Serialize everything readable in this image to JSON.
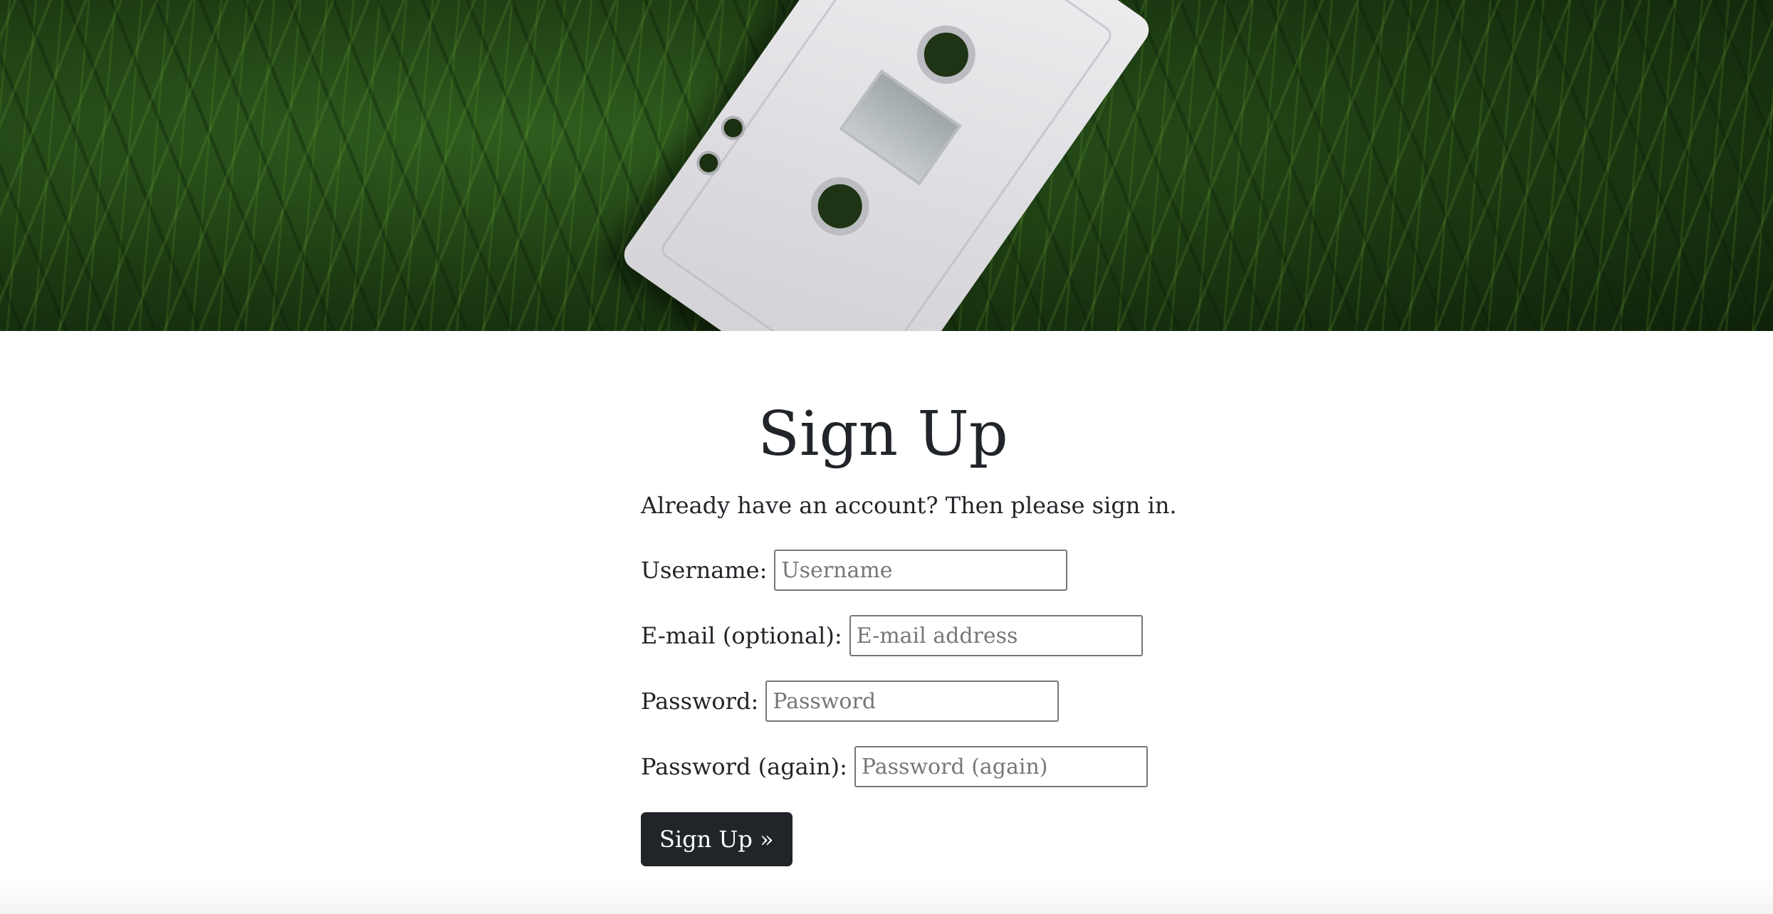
{
  "hero": {
    "image": "cassette-tape-on-grass-photo"
  },
  "signup": {
    "title": "Sign Up",
    "intro_prefix": "Already have an account? Then please ",
    "intro_link": "sign in",
    "intro_suffix": ".",
    "fields": {
      "username": {
        "label": "Username:",
        "placeholder": "Username",
        "value": ""
      },
      "email": {
        "label": "E-mail (optional):",
        "placeholder": "E-mail address",
        "value": ""
      },
      "password": {
        "label": "Password:",
        "placeholder": "Password",
        "value": ""
      },
      "password2": {
        "label": "Password (again):",
        "placeholder": "Password (again)",
        "value": ""
      }
    },
    "submit_label": "Sign Up »"
  },
  "colors": {
    "text": "#212529",
    "button_bg": "#212529",
    "button_text": "#ffffff",
    "input_border": "#767676"
  }
}
